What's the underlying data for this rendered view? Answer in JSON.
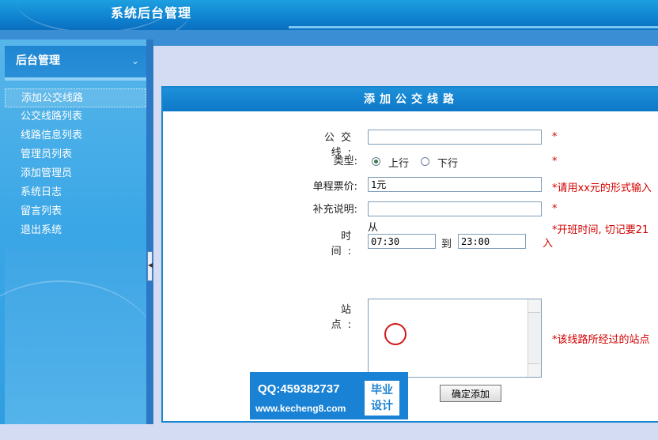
{
  "header": {
    "title": "系统后台管理"
  },
  "sidebar": {
    "title": "后台管理",
    "items": [
      {
        "label": "添加公交线路",
        "active": true
      },
      {
        "label": "公交线路列表"
      },
      {
        "label": "线路信息列表"
      },
      {
        "label": "管理员列表"
      },
      {
        "label": "添加管理员"
      },
      {
        "label": "系统日志"
      },
      {
        "label": "留言列表"
      },
      {
        "label": "退出系统"
      }
    ]
  },
  "form": {
    "title": "添加公交线路",
    "bus_line": {
      "label": "公交线:",
      "value": "",
      "required": "*"
    },
    "type": {
      "label": "类型:",
      "options": [
        "上行",
        "下行"
      ],
      "selected": "上行",
      "required": "*"
    },
    "fare": {
      "label": "单程票价:",
      "value": "1元",
      "hint": "*请用xx元的形式输入"
    },
    "note": {
      "label": "补充说明:",
      "value": "",
      "required": "*"
    },
    "time": {
      "label": "时  间:",
      "from": "从",
      "start": "07:30",
      "to": "到",
      "end": "23:00",
      "hint": "*开班时间, 切记要21",
      "hint2": "入"
    },
    "stops": {
      "label": "站  点:",
      "value": "",
      "hint": "*该线路所经过的站点"
    },
    "submit": "确定添加"
  },
  "watermark": {
    "qq": "QQ:459382737",
    "url": "www.kecheng8.com",
    "badge": [
      "毕业",
      "设计"
    ]
  },
  "colors": {
    "header": "#0f82cf",
    "accent": "#1a86d0",
    "required": "#d40000"
  }
}
